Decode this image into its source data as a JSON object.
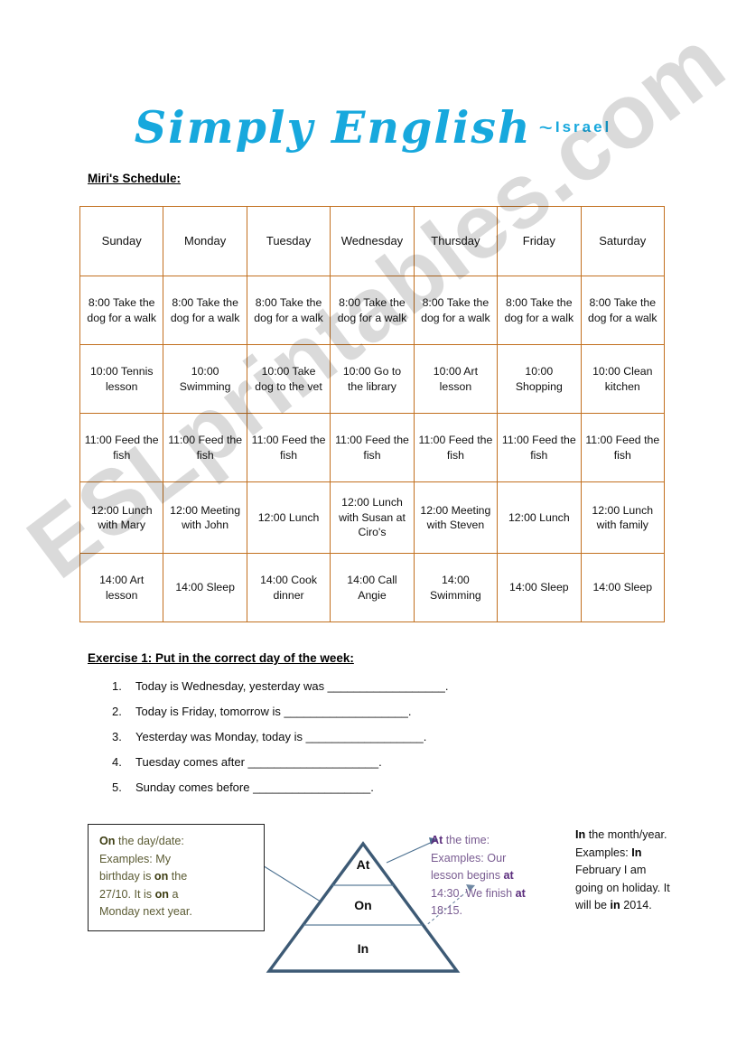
{
  "brand": {
    "name": "Simply English",
    "tilde": "~",
    "country": "Israel"
  },
  "schedule": {
    "title": "Miri's Schedule:",
    "columns": [
      "Sunday",
      "Monday",
      "Tuesday",
      "Wednesday",
      "Thursday",
      "Friday",
      "Saturday"
    ],
    "rows": [
      {
        "time": "8:00",
        "cells": [
          "8:00 Take the dog for a walk",
          "8:00 Take the dog for a walk",
          "8:00 Take the dog for a walk",
          "8:00 Take the dog for a walk",
          "8:00 Take the dog for a walk",
          "8:00 Take the dog for a walk",
          "8:00 Take the dog for a walk"
        ]
      },
      {
        "time": "10:00",
        "cells": [
          "10:00 Tennis lesson",
          "10:00 Swimming",
          "10:00 Take dog to the vet",
          "10:00 Go to the library",
          "10:00 Art lesson",
          "10:00 Shopping",
          "10:00 Clean kitchen"
        ]
      },
      {
        "time": "11:00",
        "cells": [
          "11:00 Feed the fish",
          "11:00 Feed the fish",
          "11:00 Feed the fish",
          "11:00 Feed the fish",
          "11:00 Feed the fish",
          "11:00 Feed the fish",
          "11:00 Feed the fish"
        ]
      },
      {
        "time": "12:00",
        "cells": [
          "12:00 Lunch with Mary",
          "12:00 Meeting with John",
          "12:00 Lunch",
          "12:00 Lunch with Susan at Ciro's",
          "12:00 Meeting with Steven",
          "12:00 Lunch",
          "12:00 Lunch with family"
        ]
      },
      {
        "time": "14:00",
        "cells": [
          "14:00 Art lesson",
          "14:00 Sleep",
          "14:00 Cook dinner",
          "14:00 Call Angie",
          "14:00 Swimming",
          "14:00 Sleep",
          "14:00 Sleep"
        ]
      }
    ]
  },
  "exercise": {
    "title": "Exercise 1:  Put in the correct day of the week:",
    "items": [
      {
        "num": "1.",
        "text": "Today is Wednesday, yesterday was __________________."
      },
      {
        "num": "2.",
        "text": "Today is Friday, tomorrow is ___________________."
      },
      {
        "num": "3.",
        "text": "Yesterday was Monday, today is __________________."
      },
      {
        "num": "4.",
        "text": "Tuesday comes after ____________________."
      },
      {
        "num": "5.",
        "text": "Sunday comes before __________________."
      }
    ]
  },
  "prepositions": {
    "on_box": {
      "lead_bold": "On",
      "lead_rest": " the day/date:",
      "line2": "Examples: My",
      "line3_a": "birthday is ",
      "line3_bold": "on",
      "line3_b": " the",
      "line4_a": "27/10.  It is ",
      "line4_bold": "on",
      "line4_b": " a",
      "line5": "Monday next year."
    },
    "at_block": {
      "lead_bold": "At",
      "lead_rest": " the time:",
      "line2": "Examples:  Our",
      "line3_a": "lesson begins ",
      "line3_bold": "at",
      "line4_a": "14:30.  We finish ",
      "line4_bold": "at",
      "line5": "18:15."
    },
    "in_block": {
      "lead_bold": "In",
      "lead_rest": " the month/year.",
      "line2_a": "Examples:  ",
      "line2_bold": "In",
      "line3": "February I am",
      "line4": "going on holiday.  It",
      "line5_a": "will be ",
      "line5_bold": "in",
      "line5_b": " 2014."
    },
    "pyramid": {
      "top": "At",
      "middle": "On",
      "bottom": "In"
    }
  },
  "watermark": {
    "text": "ESLprintables.com"
  },
  "colors": {
    "brand": "#17a8dd",
    "table_border": "#c2701f",
    "pyramid_stroke": "#3d5a75",
    "on_text": "#5b5b33",
    "at_text": "#7a5d92",
    "connector": "#4a6f8f"
  }
}
